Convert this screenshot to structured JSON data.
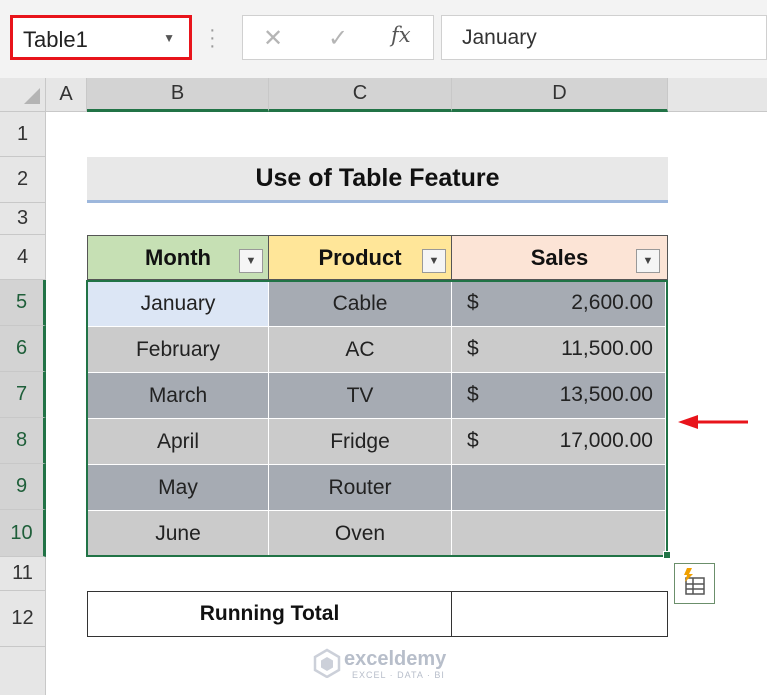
{
  "name_box": {
    "value": "Table1"
  },
  "formula_bar": {
    "content": "January",
    "cancel_icon": "✕",
    "enter_icon": "✓",
    "fx_label": "fx"
  },
  "columns": [
    "A",
    "B",
    "C",
    "D"
  ],
  "rows": [
    "1",
    "2",
    "3",
    "4",
    "5",
    "6",
    "7",
    "8",
    "9",
    "10",
    "11",
    "12"
  ],
  "title": "Use of Table Feature",
  "table": {
    "headers": [
      "Month",
      "Product",
      "Sales"
    ],
    "header_colors": [
      "#c6e0b4",
      "#ffe699",
      "#fce4d6"
    ],
    "rows": [
      {
        "month": "January",
        "product": "Cable",
        "currency": "$",
        "sales": "2,600.00"
      },
      {
        "month": "February",
        "product": "AC",
        "currency": "$",
        "sales": "11,500.00"
      },
      {
        "month": "March",
        "product": "TV",
        "currency": "$",
        "sales": "13,500.00"
      },
      {
        "month": "April",
        "product": "Fridge",
        "currency": "$",
        "sales": "17,000.00"
      },
      {
        "month": "May",
        "product": "Router",
        "currency": "",
        "sales": ""
      },
      {
        "month": "June",
        "product": "Oven",
        "currency": "",
        "sales": ""
      }
    ]
  },
  "running_total": {
    "label": "Running Total",
    "value": ""
  },
  "watermark": {
    "name": "exceldemy",
    "tagline": "EXCEL · DATA · BI"
  },
  "colors": {
    "accent": "#217346",
    "highlight": "#e8141b"
  }
}
